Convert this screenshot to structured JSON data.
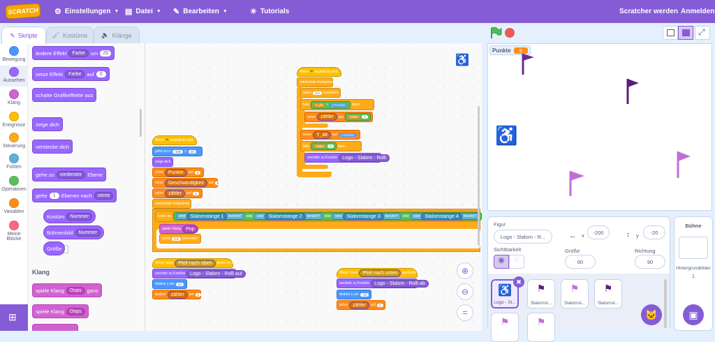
{
  "menubar": {
    "logo": "SCRATCH",
    "settings": "Einstellungen",
    "file": "Datei",
    "edit": "Bearbeiten",
    "tutorials": "Tutorials",
    "join": "Scratcher werden",
    "signin": "Anmelden"
  },
  "tabs": {
    "code": "Skripte",
    "costumes": "Kostüme",
    "sounds": "Klänge"
  },
  "categories": [
    {
      "label": "Bewegung",
      "color": "#4c97ff"
    },
    {
      "label": "Aussehen",
      "color": "#9966ff"
    },
    {
      "label": "Klang",
      "color": "#cf63cf"
    },
    {
      "label": "Ereignisse",
      "color": "#ffbf00"
    },
    {
      "label": "Steuerung",
      "color": "#ffab19"
    },
    {
      "label": "Fühlen",
      "color": "#5cb1d6"
    },
    {
      "label": "Operatoren",
      "color": "#59c059"
    },
    {
      "label": "Variablen",
      "color": "#ff8c1a"
    },
    {
      "label": "Meine Blöcke",
      "color": "#ff6680"
    }
  ],
  "palette": {
    "b1": {
      "t": "ändere Effekt",
      "d": "Farbe",
      "t2": "um",
      "n": "25"
    },
    "b2": {
      "t": "setze Effekt",
      "d": "Farbe",
      "t2": "auf",
      "n": "0"
    },
    "b3": "schalte Grafikeffekte aus",
    "b4": "zeige dich",
    "b5": "verstecke dich",
    "b6": {
      "t": "gehe zu",
      "d": "vorderster",
      "t2": "Ebene"
    },
    "b7": {
      "t": "gehe",
      "n": "1",
      "t2": "Ebenen nach",
      "d": "vorne"
    },
    "b8": {
      "t": "Kostüm",
      "d": "Nummer"
    },
    "b9": {
      "t": "Bühnenbild",
      "d": "Nummer"
    },
    "b10": "Größe",
    "sound_title": "Klang",
    "s1": {
      "t": "spiele Klang",
      "d": "Oops",
      "t2": "ganz"
    },
    "s2": {
      "t": "spiele Klang",
      "d": "Oops"
    }
  },
  "script1": {
    "hat": "Wenn",
    "hat2": "angeklickt wird",
    "l1": "gehe zu x:",
    "l1x": "-200",
    "l1y": "y:",
    "l1yv": "20",
    "l2": "zeige dich",
    "l3": "setze",
    "l3d": "Punkte",
    "l3a": "auf",
    "l3n": "0",
    "l4": "setze",
    "l4d": "Geschwindigkeit",
    "l4a": "auf",
    "l4n": "0",
    "l5": "setze",
    "l5d": "zähler",
    "l5a": "auf",
    "l5n": "0",
    "forever": "wiederhole fortlaufend",
    "wait": "warte bis",
    "touch1": "wird",
    "touch1d": "Slalomstange 1",
    "touched": "berührt?",
    "or": "oder",
    "touch2": "wird",
    "touch2d": "Slalomstange 2",
    "touch3": "wird",
    "touch3d": "Slalomstange 3",
    "touch4": "wird",
    "touch4d": "Slalomstange 4",
    "play": "spiele Klang",
    "playd": "Pop",
    "w2": "warte",
    "w2n": "0.5",
    "w2s": "Sekunden",
    "keyhat": "Wenn Taste",
    "keyd": "Pfeil nach oben",
    "keyhat2": "gedrückt wird",
    "cost": "wechsle zu Kostüm",
    "costd": "Logo - Slalom - Rolli auf",
    "chy": "ändere y um",
    "chyn": "10",
    "chc": "ändere",
    "chcd": "zähler",
    "chca": "um",
    "chcn": "1"
  },
  "script2": {
    "hat": "Wenn",
    "hat2": "angeklickt wird",
    "forever": "wiederhole fortlaufend",
    "wait": "warte",
    "waitn": "0.3",
    "waits": "Sekunden",
    "if": "falls",
    "ifd": "Y_alt",
    "lt": "<",
    "ypos": "y-Position",
    "then": "dann",
    "set": "setze",
    "setd": "zähler",
    "seta": "auf",
    "setop": "zähler",
    "setn": "1",
    "set2": "setze",
    "set2d": "Y_alt",
    "set2a": "auf",
    "set2v": "y-Position",
    "if2": "falls",
    "if2d": "zähler",
    "if2n": "0",
    "if2t": "dann",
    "cost": "wechsle zu Kostüm",
    "costd": "Logo - Slalom - Rolli"
  },
  "script3": {
    "keyhat": "Wenn Taste",
    "keyd": "Pfeil nach unten",
    "keyhat2": "gedrückt wird",
    "cost": "wechsle zu Kostüm",
    "costd": "Logo - Slalom - Rolli ab",
    "chy": "ändere y um",
    "chyn": "-10",
    "chc": "setze",
    "chcd": "zähler",
    "chca": "auf",
    "chcn": "0"
  },
  "stage": {
    "monitor_label": "Punkte",
    "monitor_value": "5"
  },
  "sprite": {
    "label": "Figur",
    "name": "Logo - Slalom - R...",
    "x_label": "x",
    "x": "-200",
    "y_label": "y",
    "y": "-20",
    "visible_label": "Sichtbarkeit",
    "size_label": "Größe",
    "size": "60",
    "dir_label": "Richtung",
    "dir": "90"
  },
  "sprites": [
    "Logo - Sl...",
    "Slalomst...",
    "Slalomst...",
    "Slalomst..."
  ],
  "stagepanel": {
    "title": "Bühne",
    "bg_label": "Hintergrundbilder",
    "bg_count": "1"
  }
}
